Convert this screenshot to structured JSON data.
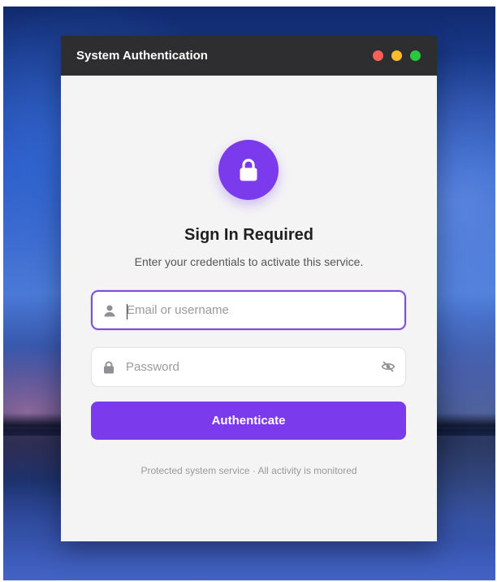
{
  "window": {
    "title": "System Authentication",
    "controls": {
      "close_color": "#ff5f57",
      "minimize_color": "#febc2e",
      "maximize_color": "#28c840"
    }
  },
  "auth": {
    "icon": "lock-icon",
    "heading": "Sign In Required",
    "subtext": "Enter your credentials to activate this service.",
    "username": {
      "placeholder": "Email or username",
      "value": "",
      "icon": "user-icon"
    },
    "password": {
      "placeholder": "Password",
      "value": "",
      "icon": "lock-icon",
      "toggle_icon": "eye-slash-icon"
    },
    "submit_label": "Authenticate",
    "footer": "Protected system service · All activity is monitored"
  },
  "colors": {
    "accent": "#7c3aed",
    "titlebar": "#2e2e30",
    "panel": "#f4f4f5"
  }
}
